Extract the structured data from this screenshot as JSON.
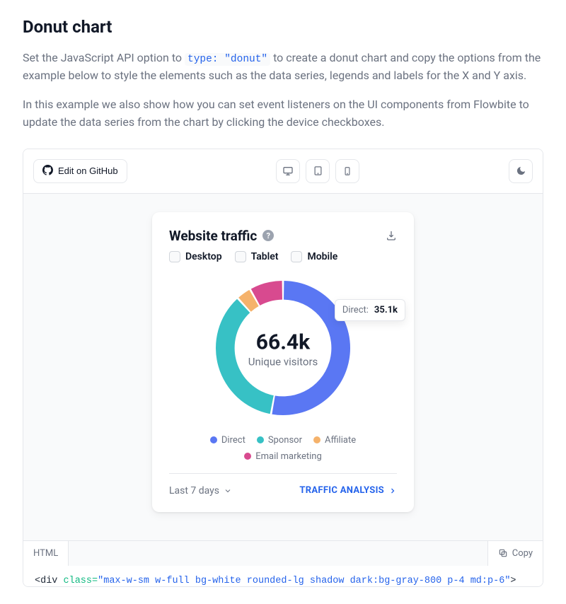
{
  "page": {
    "title": "Donut chart",
    "intro_before": "Set the JavaScript API option to ",
    "intro_code": "type: \"donut\"",
    "intro_after": " to create a donut chart and copy the options from the example below to style the elements such as the data series, legends and labels for the X and Y axis.",
    "intro2": "In this example we also show how you can set event listeners on the UI components from Flowbite to update the data series from the chart by clicking the device checkboxes."
  },
  "toolbar": {
    "edit_label": "Edit on GitHub"
  },
  "card": {
    "title": "Website traffic",
    "filters": {
      "desktop": "Desktop",
      "tablet": "Tablet",
      "mobile": "Mobile"
    },
    "center_value": "66.4k",
    "center_label": "Unique visitors",
    "tooltip_label": "Direct:",
    "tooltip_value": "35.1k",
    "period_label": "Last 7 days",
    "cta_label": "TRAFFIC ANALYSIS"
  },
  "legend": {
    "direct": "Direct",
    "sponsor": "Sponsor",
    "affiliate": "Affiliate",
    "email": "Email marketing"
  },
  "tabs": {
    "html": "HTML",
    "copy": "Copy"
  },
  "code": {
    "line1_open": "<div",
    "line1_attr": " class=",
    "line1_str": "\"max-w-sm w-full bg-white rounded-lg shadow dark:bg-gray-800 p-4 md:p-6\"",
    "line1_close": ">"
  },
  "colors": {
    "direct": "#5a77f3",
    "sponsor": "#37c1c5",
    "affiliate": "#f5b26b",
    "email": "#d84a8f"
  },
  "chart_data": {
    "type": "pie",
    "title": "Website traffic",
    "subtitle": "66.4k Unique visitors",
    "categories": [
      "Direct",
      "Sponsor",
      "Affiliate",
      "Email marketing"
    ],
    "values": [
      35.1,
      23.5,
      2.4,
      5.4
    ],
    "unit": "k",
    "total_label": "66.4k",
    "colors": [
      "#5a77f3",
      "#37c1c5",
      "#f5b26b",
      "#d84a8f"
    ],
    "tooltip": {
      "label": "Direct",
      "value": "35.1k"
    },
    "donut_inner_radius_ratio": 0.72,
    "legend_position": "bottom"
  }
}
